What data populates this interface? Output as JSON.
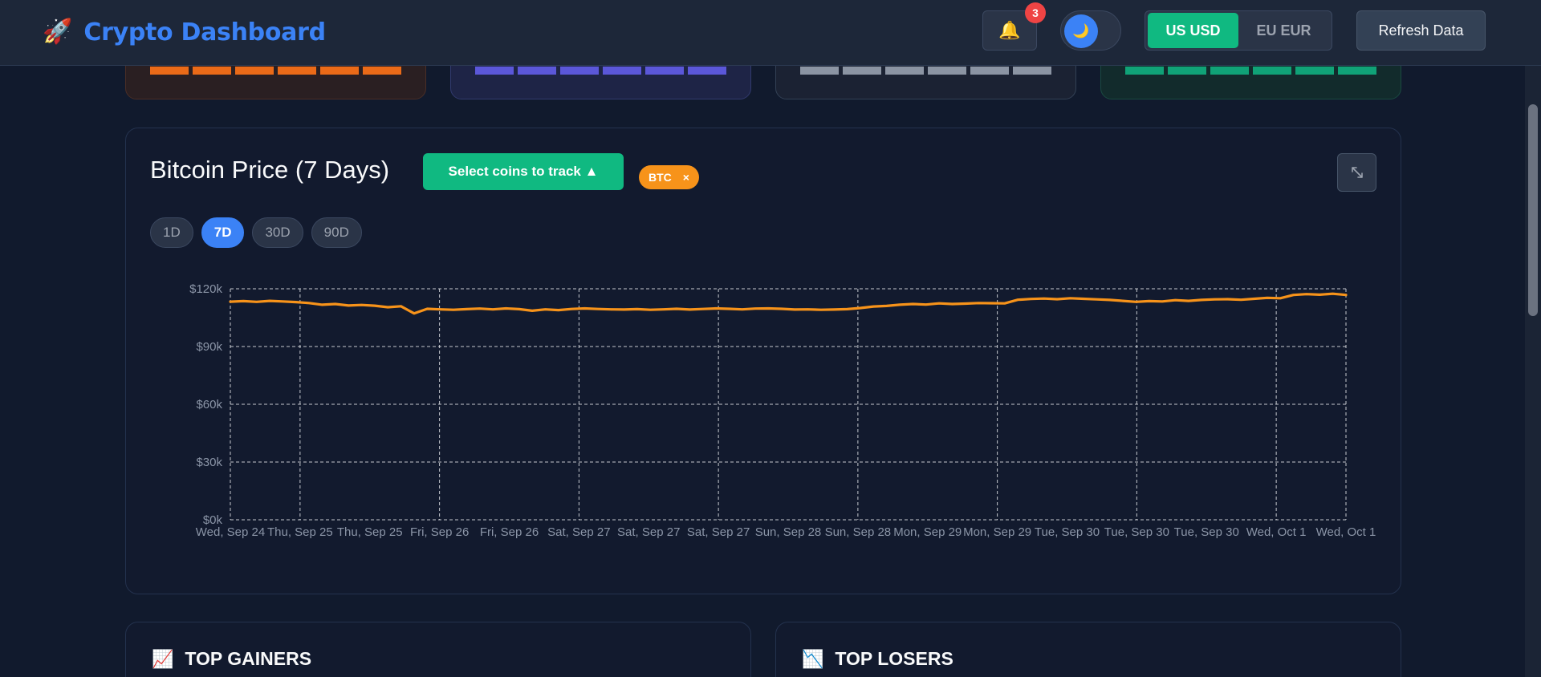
{
  "header": {
    "brand_icon": "rocket-icon",
    "brand_icon_glyph": "🚀",
    "title": "Crypto Dashboard",
    "notifications": {
      "icon": "bell-icon",
      "glyph": "🔔",
      "badge": "3"
    },
    "theme_toggle": {
      "icon": "moon-icon",
      "glyph": "🌙"
    },
    "currencies": [
      {
        "label": "US USD",
        "active": true
      },
      {
        "label": "EU EUR",
        "active": false
      }
    ],
    "refresh_label": "Refresh Data"
  },
  "stat_cards": [
    {
      "color": "#ea6a18"
    },
    {
      "color": "#5b57d9"
    },
    {
      "color": "#8b94a3"
    },
    {
      "color": "#10a277"
    }
  ],
  "chart_panel": {
    "title": "Bitcoin Price (7 Days)",
    "select_label": "Select coins to track ▲",
    "chip": {
      "label": "BTC",
      "close": "×"
    },
    "expand_icon": "expand-icon",
    "ranges": [
      {
        "label": "1D",
        "active": false
      },
      {
        "label": "7D",
        "active": true
      },
      {
        "label": "30D",
        "active": false
      },
      {
        "label": "90D",
        "active": false
      }
    ]
  },
  "chart_data": {
    "type": "line",
    "title": "",
    "xlabel": "",
    "ylabel": "",
    "ylim": [
      0,
      120000
    ],
    "y_ticks": [
      "$0k",
      "$30k",
      "$60k",
      "$90k",
      "$120k"
    ],
    "x_ticks": [
      "Wed, Sep 24",
      "Thu, Sep 25",
      "Thu, Sep 25",
      "Fri, Sep 26",
      "Fri, Sep 26",
      "Sat, Sep 27",
      "Sat, Sep 27",
      "Sat, Sep 27",
      "Sun, Sep 28",
      "Sun, Sep 28",
      "Mon, Sep 29",
      "Mon, Sep 29",
      "Tue, Sep 30",
      "Tue, Sep 30",
      "Tue, Sep 30",
      "Wed, Oct 1",
      "Wed, Oct 1"
    ],
    "grid": true,
    "line_color": "#f7931a",
    "series": [
      {
        "values": [
          113300,
          113600,
          113200,
          113700,
          113400,
          113100,
          112600,
          111700,
          112100,
          111300,
          111600,
          111200,
          110400,
          110900,
          107200,
          109600,
          109300,
          109100,
          109400,
          109700,
          109300,
          109800,
          109400,
          108600,
          109300,
          108900,
          109500,
          109800,
          109500,
          109300,
          109200,
          109400,
          109100,
          109300,
          109600,
          109200,
          109500,
          109800,
          109600,
          109300,
          109700,
          109800,
          109600,
          109200,
          109300,
          109100,
          109200,
          109400,
          110000,
          110800,
          111100,
          111700,
          112100,
          111800,
          112400,
          112100,
          112300,
          112600,
          112500,
          112400,
          114300,
          114700,
          114900,
          114600,
          115100,
          114800,
          114500,
          114200,
          113700,
          113200,
          113600,
          113400,
          114100,
          113700,
          114200,
          114500,
          114600,
          114300,
          114800,
          115300,
          115100,
          116800,
          117200,
          116900,
          117400,
          116800
        ]
      }
    ]
  },
  "top_gainers": {
    "icon": "chart-up-icon",
    "glyph": "📈",
    "title": "TOP GAINERS"
  },
  "top_losers": {
    "icon": "chart-down-icon",
    "glyph": "📉",
    "title": "TOP LOSERS"
  }
}
